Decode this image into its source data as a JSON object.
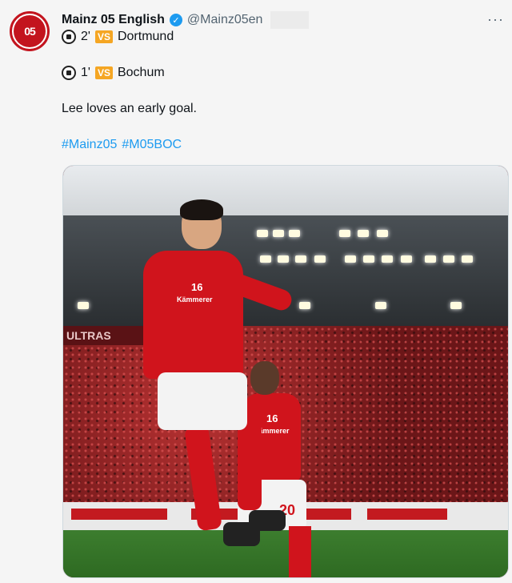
{
  "account": {
    "name": "Mainz 05 English",
    "handle": "@Mainz05en",
    "avatar_text": "05"
  },
  "icons": {
    "verified": "verified-badge-icon",
    "more": "more-options-icon",
    "ball": "soccer-ball-icon"
  },
  "tweet": {
    "matches": [
      {
        "minute": "2'",
        "vs": "VS",
        "opponent": "Dortmund"
      },
      {
        "minute": "1'",
        "vs": "VS",
        "opponent": "Bochum"
      }
    ],
    "body": "Lee loves an early goal.",
    "hashtags": [
      "#Mainz05",
      "#M05BOC"
    ]
  },
  "photo": {
    "banner_text": "ULTRAS",
    "shirt_sponsor": "Kämmerer",
    "shirt_number_main": "16",
    "shorts_number_back": "20"
  },
  "colors": {
    "brand_red": "#c3141e",
    "link": "#1d9bf0",
    "vs_badge": "#f5a623"
  }
}
